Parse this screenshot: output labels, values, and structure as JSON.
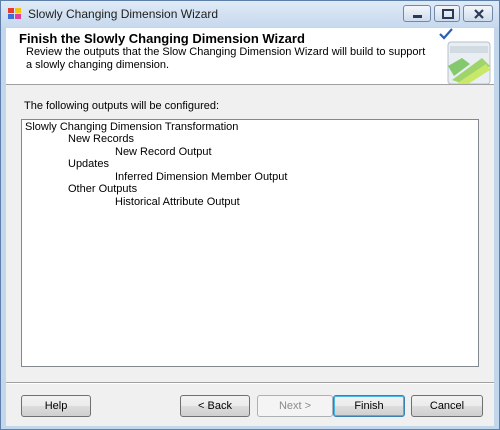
{
  "window": {
    "title": "Slowly Changing Dimension Wizard",
    "icon": "ssis-wizard-icon",
    "controls": [
      "minimize-icon",
      "maximize-icon",
      "close-icon"
    ]
  },
  "header": {
    "title": "Finish the Slowly Changing Dimension Wizard",
    "description": "Review the outputs that the Slow Changing Dimension Wizard will build to support a slowly changing dimension.",
    "check_icon": "checkmark-icon",
    "graphic": "wizard-graphic-icon"
  },
  "main": {
    "outputs_label": "The following outputs will be configured:",
    "tree": [
      {
        "text": "Slowly Changing Dimension Transformation",
        "level": 0
      },
      {
        "text": "New Records",
        "level": 1
      },
      {
        "text": "New Record Output",
        "level": 2
      },
      {
        "text": "Updates",
        "level": 1
      },
      {
        "text": "Inferred Dimension Member Output",
        "level": 2
      },
      {
        "text": "Other Outputs",
        "level": 1
      },
      {
        "text": "Historical Attribute Output",
        "level": 2
      }
    ]
  },
  "buttons": {
    "help": "Help",
    "back": "< Back",
    "next": "Next >",
    "finish": "Finish",
    "cancel": "Cancel"
  },
  "colors": {
    "window_frame": "#c2d6ec",
    "dialog_background": "#f0f0f0",
    "default_button_border": "#3c7fb1"
  }
}
